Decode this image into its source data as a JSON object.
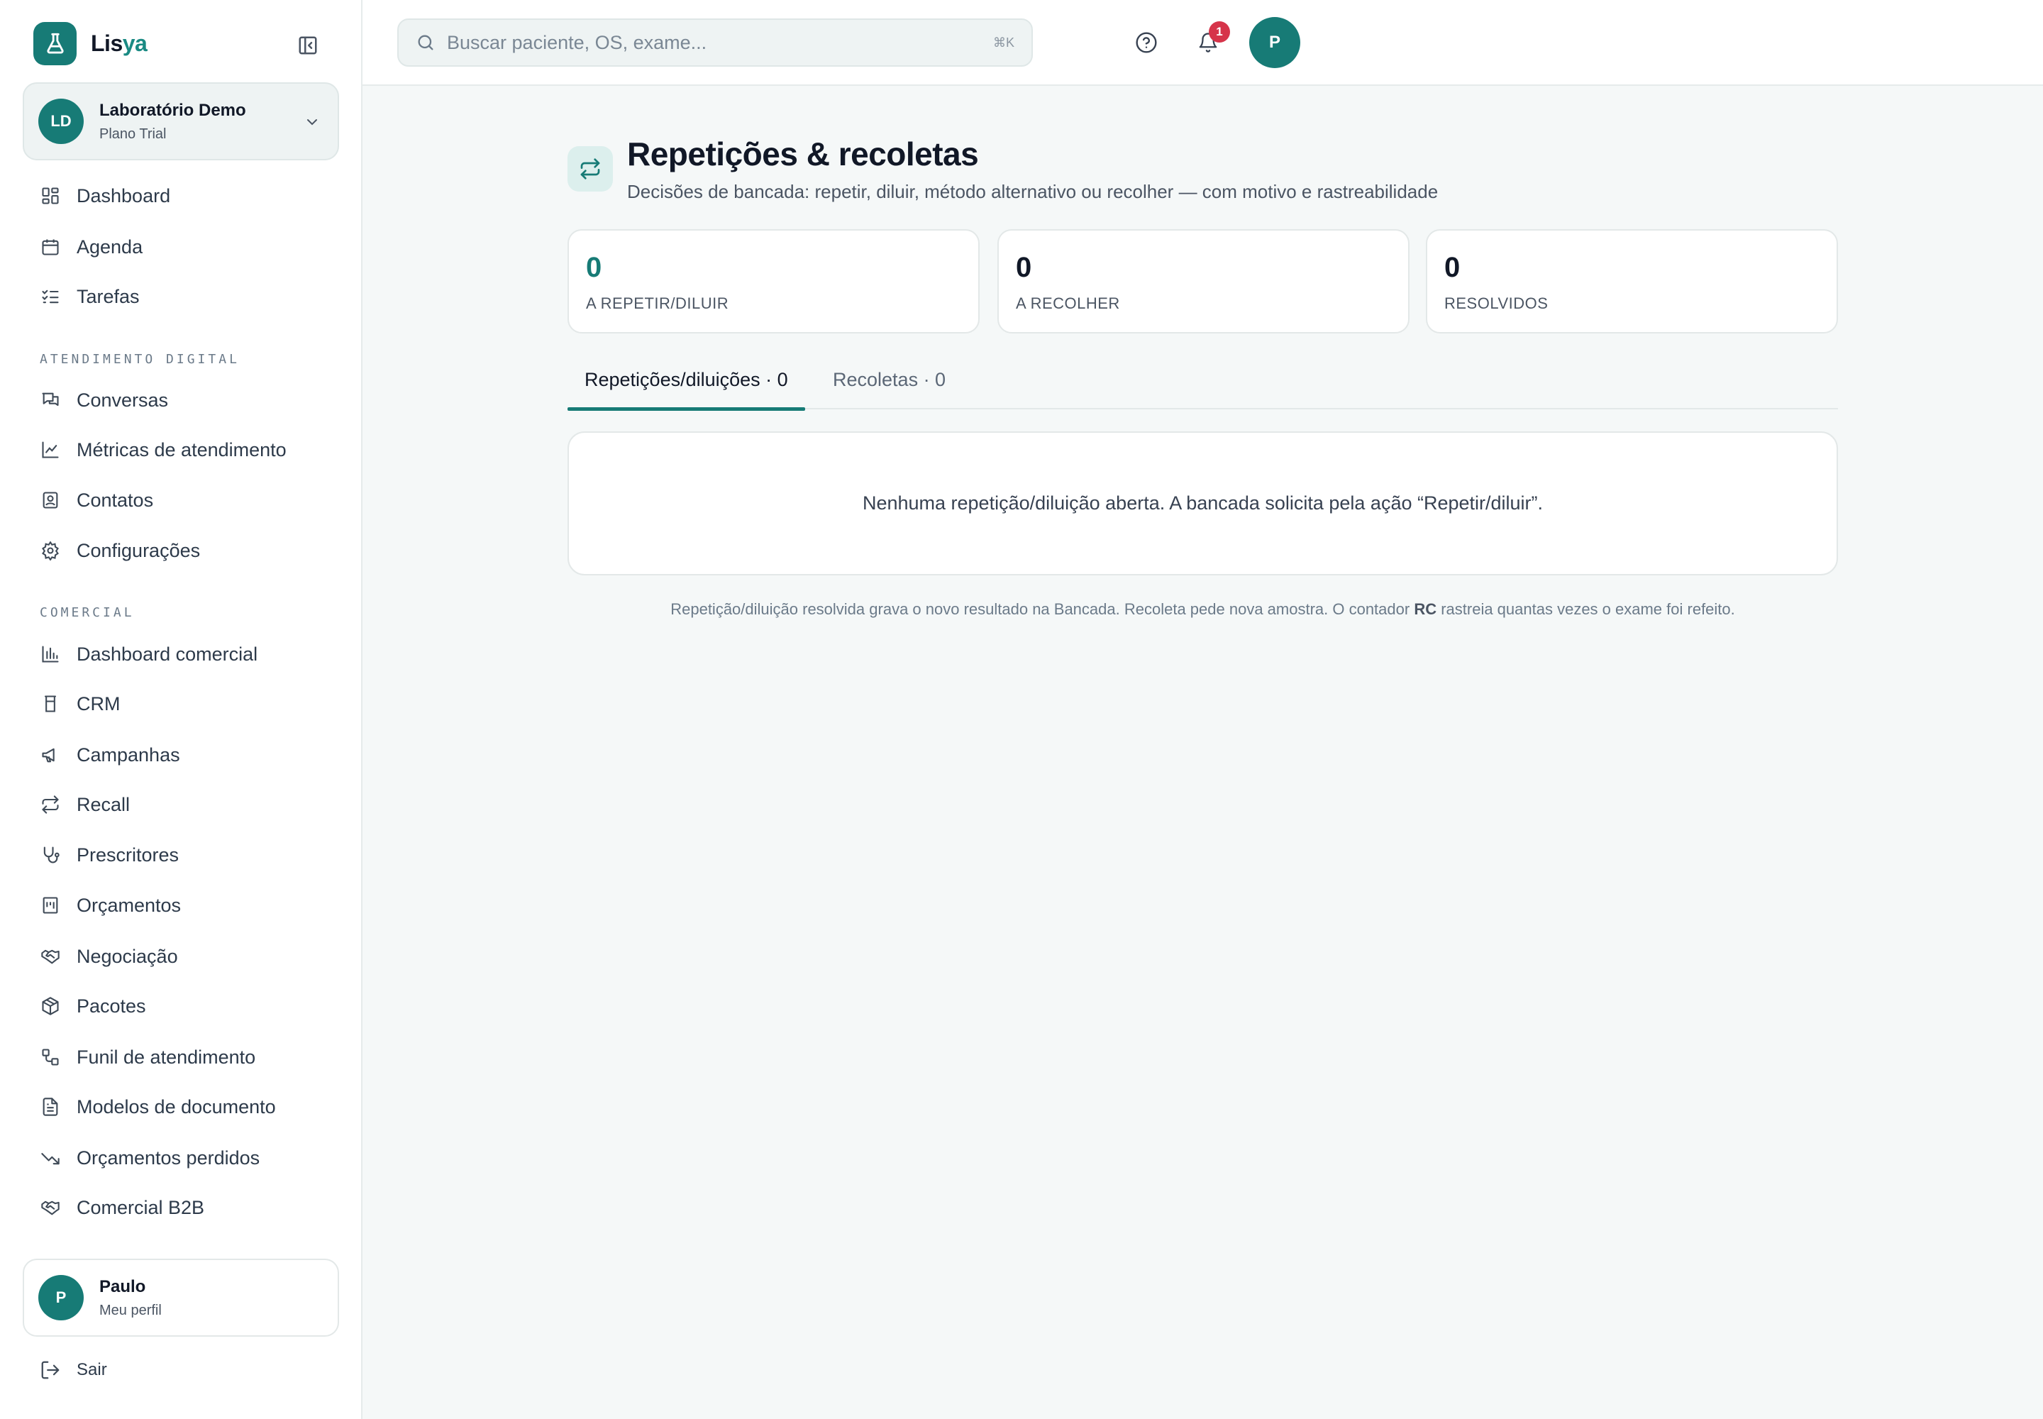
{
  "brand": {
    "name_part1": "Lis",
    "name_part2": "ya"
  },
  "org": {
    "initials": "LD",
    "name": "Laboratório Demo",
    "plan": "Plano Trial"
  },
  "nav": {
    "main": [
      {
        "label": "Dashboard",
        "icon": "layout-dashboard-icon"
      },
      {
        "label": "Agenda",
        "icon": "calendar-icon"
      },
      {
        "label": "Tarefas",
        "icon": "list-checks-icon"
      }
    ],
    "section_atendimento": "ATENDIMENTO DIGITAL",
    "atendimento": [
      {
        "label": "Conversas",
        "icon": "messages-icon"
      },
      {
        "label": "Métricas de atendimento",
        "icon": "line-chart-icon"
      },
      {
        "label": "Contatos",
        "icon": "contact-icon"
      },
      {
        "label": "Configurações",
        "icon": "gear-icon"
      }
    ],
    "section_comercial": "COMERCIAL",
    "comercial": [
      {
        "label": "Dashboard comercial",
        "icon": "bar-chart-icon"
      },
      {
        "label": "CRM",
        "icon": "crm-icon"
      },
      {
        "label": "Campanhas",
        "icon": "megaphone-icon"
      },
      {
        "label": "Recall",
        "icon": "repeat-icon"
      },
      {
        "label": "Prescritores",
        "icon": "stethoscope-icon"
      },
      {
        "label": "Orçamentos",
        "icon": "receipt-icon"
      },
      {
        "label": "Negociação",
        "icon": "handshake-icon"
      },
      {
        "label": "Pacotes",
        "icon": "package-icon"
      },
      {
        "label": "Funil de atendimento",
        "icon": "workflow-icon"
      },
      {
        "label": "Modelos de documento",
        "icon": "file-text-icon"
      },
      {
        "label": "Orçamentos perdidos",
        "icon": "trending-down-icon"
      },
      {
        "label": "Comercial B2B",
        "icon": "handshake-icon"
      }
    ]
  },
  "profile": {
    "initial": "P",
    "name": "Paulo",
    "subtitle": "Meu perfil"
  },
  "logout_label": "Sair",
  "search": {
    "placeholder": "Buscar paciente, OS, exame...",
    "shortcut": "⌘K"
  },
  "topbar": {
    "notification_count": "1",
    "avatar_initial": "P"
  },
  "page": {
    "title": "Repetições & recoletas",
    "subtitle": "Decisões de bancada: repetir, diluir, método alternativo ou recolher — com motivo e rastreabilidade"
  },
  "stats": [
    {
      "value": "0",
      "label": "A REPETIR/DILUIR"
    },
    {
      "value": "0",
      "label": "A RECOLHER"
    },
    {
      "value": "0",
      "label": "RESOLVIDOS"
    }
  ],
  "tabs": [
    {
      "label": "Repetições/diluições · 0",
      "active": true
    },
    {
      "label": "Recoletas · 0",
      "active": false
    }
  ],
  "empty_message": "Nenhuma repetição/diluição aberta. A bancada solicita pela ação “Repetir/diluir”.",
  "footnote": {
    "before": "Repetição/diluição resolvida grava o novo resultado na Bancada. Recoleta pede nova amostra. O contador ",
    "bold": "RC",
    "after": " rastreia quantas vezes o exame foi refeito."
  },
  "colors": {
    "accent": "#177b76",
    "badge": "#d6344a",
    "background": "#f5f8f8"
  }
}
